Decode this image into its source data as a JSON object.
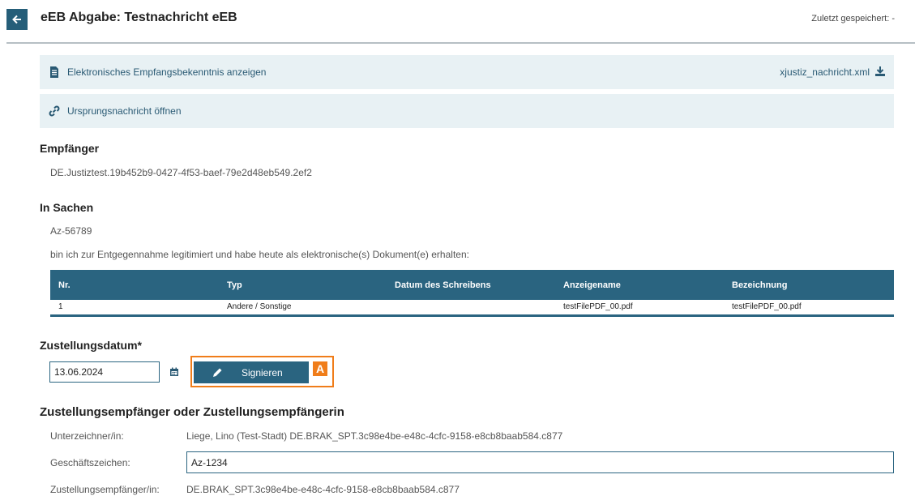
{
  "header": {
    "title": "eEB Abgabe: Testnachricht eEB",
    "saved_status": "Zuletzt gespeichert: -"
  },
  "bars": {
    "eeb_link": "Elektronisches Empfangsbekenntnis anzeigen",
    "xml_file": "xjustiz_nachricht.xml",
    "origin_link": "Ursprungsnachricht öffnen"
  },
  "recipient": {
    "heading": "Empfänger",
    "value": "DE.Justiztest.19b452b9-0427-4f53-baef-79e2d48eb549.2ef2"
  },
  "case": {
    "heading": "In Sachen",
    "reference": "Az-56789",
    "statement": "bin ich zur Entgegennahme legitimiert und habe heute als elektronische(s) Dokument(e) erhalten:"
  },
  "documents_table": {
    "columns": [
      "Nr.",
      "Typ",
      "Datum des Schreibens",
      "Anzeigename",
      "Bezeichnung"
    ],
    "rows": [
      [
        "1",
        "Andere / Sonstige",
        "",
        "testFilePDF_00.pdf",
        "testFilePDF_00.pdf"
      ]
    ]
  },
  "delivery": {
    "heading": "Zustellungsdatum*",
    "date_value": "13.06.2024",
    "sign_label": "Signieren",
    "highlight_badge": "A"
  },
  "delivery_recipient": {
    "heading": "Zustellungsempfänger oder Zustellungsempfängerin",
    "signer_label": "Unterzeichner/in:",
    "signer_value": "Liege, Lino (Test-Stadt) DE.BRAK_SPT.3c98e4be-e48c-4cfc-9158-e8cb8baab584.c877",
    "file_ref_label": "Geschäftszeichen:",
    "file_ref_value": "Az-1234",
    "recipient_label": "Zustellungsempfänger/in:",
    "recipient_value": "DE.BRAK_SPT.3c98e4be-e48c-4cfc-9158-e8cb8baab584.c877"
  },
  "colors": {
    "primary": "#2a6480",
    "bar_background": "#e8f1f4",
    "highlight": "#f07d1a"
  },
  "icons": [
    "back-arrow-icon",
    "document-icon",
    "download-icon",
    "link-icon",
    "calendar-icon",
    "pencil-icon"
  ]
}
